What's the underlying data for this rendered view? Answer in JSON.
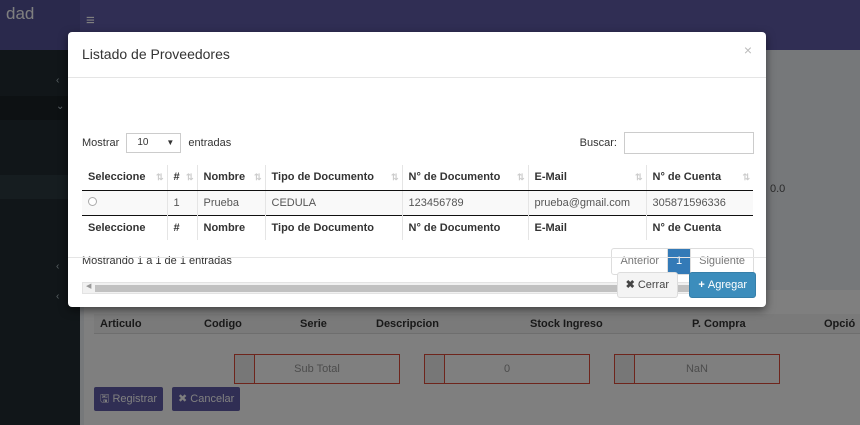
{
  "background": {
    "logo_fragment": "dad",
    "hamburger": "≡",
    "value_fragment": "0.0",
    "table_headers": [
      "Articulo",
      "Codigo",
      "Serie",
      "Descripcion",
      "Stock Ingreso",
      "P. Compra",
      "Opció"
    ],
    "totals": [
      {
        "label": "Sub Total"
      },
      {
        "label": "0"
      },
      {
        "label": "NaN"
      }
    ],
    "registrar_label": "Registrar",
    "cancelar_label": "Cancelar"
  },
  "modal": {
    "title": "Listado de Proveedores",
    "close_glyph": "×",
    "length": {
      "prefix": "Mostrar",
      "value": "10",
      "suffix": "entradas"
    },
    "search": {
      "label": "Buscar:",
      "value": ""
    },
    "columns": [
      "Seleccione",
      "#",
      "Nombre",
      "Tipo de Documento",
      "N° de Documento",
      "E-Mail",
      "N° de Cuenta"
    ],
    "rows": [
      {
        "num": "1",
        "nombre": "Prueba",
        "tipo": "CEDULA",
        "documento": "123456789",
        "email": "prueba@gmail.com",
        "cuenta": "305871596336"
      }
    ],
    "info": "Mostrando 1 a 1 de 1 entradas",
    "pagination": {
      "prev": "Anterior",
      "current": "1",
      "next": "Siguiente"
    },
    "footer": {
      "close_label": "Cerrar",
      "add_label": "Agregar"
    }
  }
}
